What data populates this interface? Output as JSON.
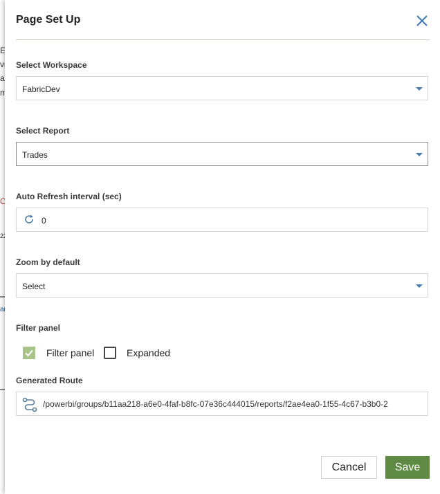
{
  "background": {
    "fragments": [
      "E",
      "vi",
      "ar",
      "m",
      "O",
      "22",
      "ar"
    ]
  },
  "dialog": {
    "title": "Page Set Up",
    "close_label": "close"
  },
  "workspace": {
    "label": "Select Workspace",
    "value": "FabricDev"
  },
  "report": {
    "label": "Select Report",
    "value": "Trades"
  },
  "refresh": {
    "label": "Auto Refresh interval (sec)",
    "value": "0"
  },
  "zoom": {
    "label": "Zoom by default",
    "value": "Select"
  },
  "filter": {
    "label": "Filter panel",
    "filter_panel": {
      "label": "Filter panel",
      "checked": true
    },
    "expanded": {
      "label": "Expanded",
      "checked": false
    }
  },
  "route": {
    "label": "Generated Route",
    "value": "/powerbi/groups/b11aa218-a6e0-4faf-b8fc-07e36c444015/reports/f2ae4ea0-1f55-4c67-b3b0-2"
  },
  "buttons": {
    "cancel": "Cancel",
    "save": "Save"
  },
  "colors": {
    "save_bg": "#5f8a43",
    "checkbox_checked": "#a8c48a",
    "accent_icon": "#4a7bb0",
    "divider": "#c8cbb7"
  }
}
